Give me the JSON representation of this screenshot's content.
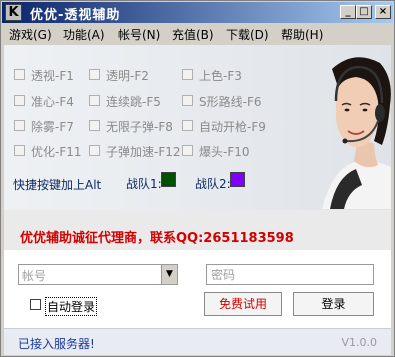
{
  "window": {
    "title": "优优-透视辅助",
    "min_glyph": "_",
    "max_glyph": "□",
    "close_glyph": "×"
  },
  "menu": [
    {
      "label": "游戏(G)"
    },
    {
      "label": "功能(A)"
    },
    {
      "label": "帐号(N)"
    },
    {
      "label": "充值(B)"
    },
    {
      "label": "下载(D)"
    },
    {
      "label": "帮助(H)"
    }
  ],
  "features": [
    {
      "label": "透视-F1"
    },
    {
      "label": "透明-F2"
    },
    {
      "label": "上色-F3"
    },
    {
      "label": "准心-F4"
    },
    {
      "label": "连续跳-F5"
    },
    {
      "label": "S形路线-F6"
    },
    {
      "label": "除雾-F7"
    },
    {
      "label": "无限子弹-F8"
    },
    {
      "label": "自动开枪-F9"
    },
    {
      "label": "优化-F11"
    },
    {
      "label": "子弹加速-F12"
    },
    {
      "label": "爆头-F10"
    }
  ],
  "hotkey_hint": "快捷按键加上Alt",
  "teams": {
    "team1_label": "战队1:",
    "team1_color": "#005000",
    "team2_label": "战队2:",
    "team2_color": "#8000ff"
  },
  "promo_text": "优优辅助诚征代理商，联系QQ:2651183598",
  "login": {
    "account_placeholder": "帐号",
    "password_placeholder": "密码",
    "auto_login_label": "自动登录",
    "trial_button": "免费试用",
    "login_button": "登录"
  },
  "status": {
    "connection": "已接入服务器!",
    "version": "V1.0.0"
  },
  "colors": {
    "accent_red": "#d40000",
    "title_blue": "#0a246a"
  }
}
